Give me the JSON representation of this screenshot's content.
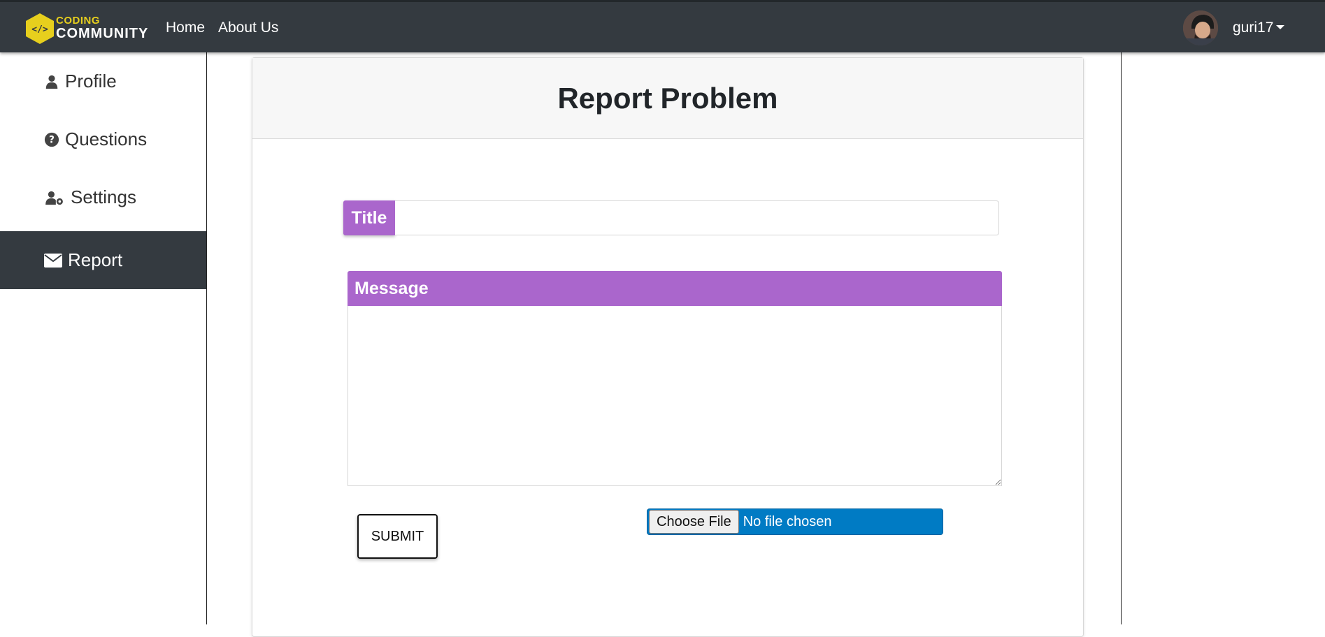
{
  "brand": {
    "top": "CODING",
    "bottom": "COMMUNITY",
    "icon": "code-hexagon-icon",
    "hex_color": "#e7cf1d"
  },
  "nav": {
    "home": "Home",
    "about": "About Us"
  },
  "user": {
    "name": "guri17",
    "avatar_icon": "user-avatar"
  },
  "sidebar": {
    "items": [
      {
        "label": "Profile",
        "icon": "user-icon"
      },
      {
        "label": "Questions",
        "icon": "question-circle-icon"
      },
      {
        "label": "Settings",
        "icon": "user-gear-icon"
      },
      {
        "label": "Report",
        "icon": "envelope-icon",
        "active": true
      }
    ]
  },
  "form": {
    "heading": "Report Problem",
    "title_label": "Title",
    "title_value": "",
    "message_label": "Message",
    "message_value": "",
    "submit_label": "SUBMIT",
    "file_button": "Choose File",
    "file_status": "No file chosen"
  },
  "colors": {
    "navbar": "#343a40",
    "accent_purple": "#aa66cc",
    "file_blue": "#007bc4"
  }
}
